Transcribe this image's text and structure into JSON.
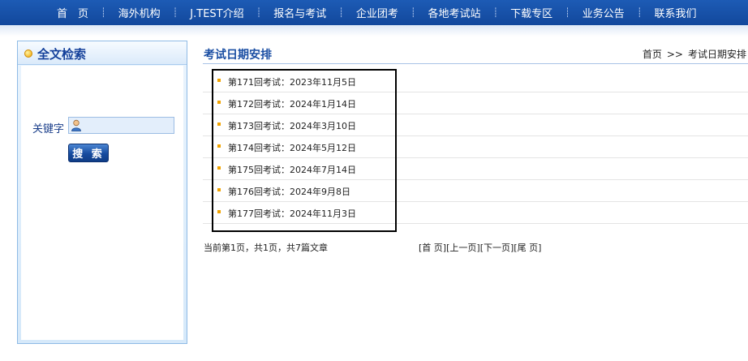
{
  "nav": {
    "items": [
      "首　页",
      "海外机构",
      "J.TEST介绍",
      "报名与考试",
      "企业团考",
      "各地考试站",
      "下载专区",
      "业务公告",
      "联系我们"
    ],
    "separator": "┊"
  },
  "search_panel": {
    "title": "全文检索",
    "keyword_label": "关键字",
    "keyword_value": "",
    "search_button": "搜 索"
  },
  "main": {
    "title": "考试日期安排",
    "breadcrumb": {
      "home": "首页",
      "separator": ">>",
      "current": "考试日期安排"
    },
    "items": [
      "第171回考试：2023年11月5日",
      "第172回考试：2024年1月14日",
      "第173回考试：2024年3月10日",
      "第174回考试：2024年5月12日",
      "第175回考试：2024年7月14日",
      "第176回考试：2024年9月8日",
      "第177回考试：2024年11月3日"
    ],
    "pager_info": "当前第1页，共1页，共7篇文章",
    "pager": {
      "first": "[首 页]",
      "prev": "[上一页]",
      "next": "[下一页]",
      "last": "[尾 页]"
    }
  },
  "colors": {
    "nav_bg": "#1a55ae",
    "accent": "#1a4ea3",
    "bullet": "#f1a300"
  }
}
